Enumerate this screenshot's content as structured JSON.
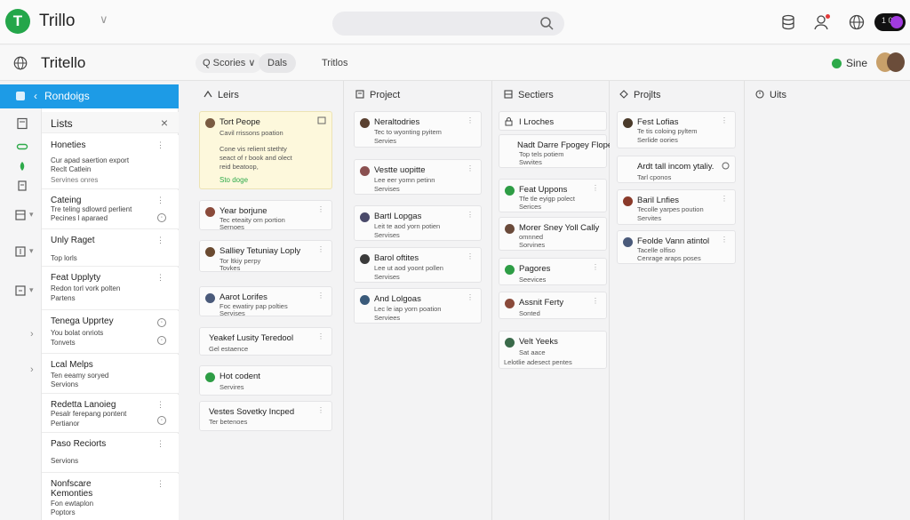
{
  "app": {
    "title": "Trillo",
    "logo_letter": "T"
  },
  "header": {
    "toggle_text": "1 0"
  },
  "board": {
    "title": "Tritello",
    "tabs": [
      "Q Scories ∨",
      "Dals",
      "Tritlos"
    ],
    "sync_label": "Sine"
  },
  "sidebar": {
    "section": "Rondoigs",
    "panel_title": "Lists",
    "items": [
      {
        "title": "Honeties",
        "lines": [
          "Cur apad saertion export",
          "Reclt Catlein",
          "Servines onres"
        ]
      },
      {
        "title": "Cateing",
        "lines": [
          "Tre teling sdlowrd perlient",
          "Pecines l aparaed"
        ]
      },
      {
        "title": "Unly Raget",
        "lines": [
          "Top lorls"
        ]
      },
      {
        "title": "Feat Upplyty",
        "lines": [
          "Redon torl vork polten",
          "Partens"
        ]
      },
      {
        "title": "Tenega Upprtey",
        "lines": [
          "You bolat onriots",
          "Tonvets"
        ]
      },
      {
        "title": "Lcal Melps",
        "lines": [
          "Ten eeamy soryed",
          "Servions"
        ]
      },
      {
        "title": "Redetta Lanoieg",
        "lines": [
          "Pesalr ferepang pontent",
          "Pertianor"
        ]
      },
      {
        "title": "Paso Reciorts",
        "lines": [
          "Servions"
        ]
      },
      {
        "title": "Nonfscare Kemonties",
        "lines": [
          "Fon ewtaplon",
          "Poptors"
        ]
      }
    ]
  },
  "columns": [
    {
      "title": "Leirs",
      "cards": [
        {
          "title": "Tort Peope",
          "lines": [
            "Cavil rrissons poation",
            "",
            "Cone vis relient stethty",
            "seact of r book and olect",
            "reid beatoop,"
          ],
          "badge": "Sto doge"
        },
        {
          "title": "Year borjune",
          "lines": [
            "Tec eteaity orn portion",
            "Sernoes"
          ]
        },
        {
          "title": "Salliey Tetuniay Loply",
          "lines": [
            "Tor ltkiy perpy",
            "Tovkes"
          ]
        },
        {
          "title": "Aarot Lorifes",
          "lines": [
            "Foc ewatiry pap polties",
            "Servises"
          ]
        },
        {
          "title": "Yeakef Lusity Teredool",
          "lines": [
            "Gel estaence"
          ]
        },
        {
          "title": "Hot codent",
          "lines": [
            "Servires"
          ]
        },
        {
          "title": "Vestes Sovetky Incped",
          "lines": [
            "Ter betenoes"
          ]
        }
      ]
    },
    {
      "title": "Project",
      "cards": [
        {
          "title": "Neraltodries",
          "lines": [
            "Tec to wyonting pyitem",
            "Servies"
          ]
        },
        {
          "title": "Vestte uopitte",
          "lines": [
            "Lee eer yomn petinn",
            "Servises"
          ]
        },
        {
          "title": "Bartl Lopgas",
          "lines": [
            "Leit te aod yorn potien",
            "Servises"
          ]
        },
        {
          "title": "Barol oftites",
          "lines": [
            "Lee ut aod yoont pollen",
            "Servises"
          ]
        },
        {
          "title": "And Lolgoas",
          "lines": [
            "Lec le iap yorn poation",
            "Serviees"
          ]
        }
      ]
    },
    {
      "title": "Sectiers",
      "cards": [
        {
          "title": "I Lroches",
          "lines": []
        },
        {
          "title": "Nadt Darre Fpogey Flope",
          "lines": [
            "Top tels potiem",
            "Swvites"
          ]
        },
        {
          "title": "Feat Uppons",
          "lines": [
            "Tfe tle eyigp polect",
            "Serices"
          ]
        },
        {
          "title": "Morer Sney Yoll Cally",
          "lines": [
            "omnned",
            "Sorvines"
          ]
        },
        {
          "title": "Pagores",
          "lines": [
            "Seevices"
          ]
        },
        {
          "title": "Assnit Ferty",
          "lines": [
            "Sonted"
          ]
        },
        {
          "title": "Velt Yeeks",
          "lines": [
            "Sat aace",
            "Lelotlie adesect pentes"
          ]
        }
      ]
    },
    {
      "title": "Projlts",
      "cards": [
        {
          "title": "Fest Lofias",
          "lines": [
            "Te tis coloing pyltem",
            "Serlide oories"
          ]
        },
        {
          "title": "Ardt tall incom ytaliy.",
          "lines": [
            "Tarl cponos"
          ]
        },
        {
          "title": "Baril Lnfies",
          "lines": [
            "Tecolle yarpes poution",
            "Servites"
          ]
        },
        {
          "title": "Feolde Vann atintol",
          "lines": [
            "Tacelle olfiso",
            "Cenrage araps poses"
          ]
        }
      ]
    },
    {
      "title": "Uits",
      "cards": []
    }
  ]
}
